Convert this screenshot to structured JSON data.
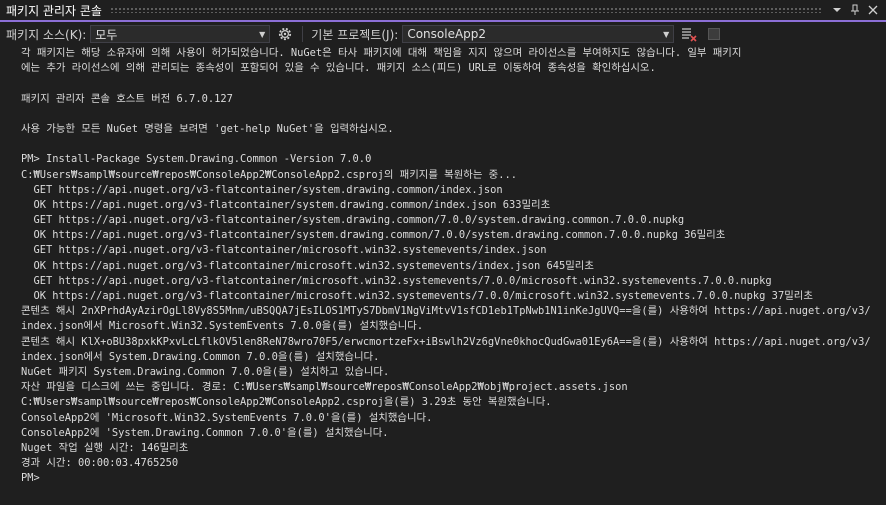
{
  "titlebar": {
    "title": "패키지 관리자 콘솔",
    "menu_icon": "dropdown-arrow-icon",
    "pin_icon": "pin-icon",
    "close_icon": "close-icon",
    "accent_color": "#8c6fd6"
  },
  "toolbar": {
    "source_label": "패키지 소스(K):",
    "source_value": "모두",
    "settings_icon": "gear-icon",
    "project_label": "기본 프로젝트(J):",
    "project_value": "ConsoleApp2",
    "clear_icon": "clear-console-icon",
    "stop_icon": "stop-icon"
  },
  "console": {
    "lines": [
      "각 패키지는 해당 소유자에 의해 사용이 허가되었습니다. NuGet은 타사 패키지에 대해 책임을 지지 않으며 라이선스를 부여하지도 않습니다. 일부 패키지",
      "에는 추가 라이선스에 의해 관리되는 종속성이 포함되어 있을 수 있습니다. 패키지 소스(피드) URL로 이동하여 종속성을 확인하십시오.",
      "",
      "패키지 관리자 콘솔 호스트 버전 6.7.0.127",
      "",
      "사용 가능한 모든 NuGet 명령을 보려면 'get-help NuGet'을 입력하십시오.",
      "",
      "PM> Install-Package System.Drawing.Common -Version 7.0.0",
      "C:₩Users₩sampl₩source₩repos₩ConsoleApp2₩ConsoleApp2.csproj의 패키지를 복원하는 중...",
      "  GET https://api.nuget.org/v3-flatcontainer/system.drawing.common/index.json",
      "  OK https://api.nuget.org/v3-flatcontainer/system.drawing.common/index.json 633밀리초",
      "  GET https://api.nuget.org/v3-flatcontainer/system.drawing.common/7.0.0/system.drawing.common.7.0.0.nupkg",
      "  OK https://api.nuget.org/v3-flatcontainer/system.drawing.common/7.0.0/system.drawing.common.7.0.0.nupkg 36밀리초",
      "  GET https://api.nuget.org/v3-flatcontainer/microsoft.win32.systemevents/index.json",
      "  OK https://api.nuget.org/v3-flatcontainer/microsoft.win32.systemevents/index.json 645밀리초",
      "  GET https://api.nuget.org/v3-flatcontainer/microsoft.win32.systemevents/7.0.0/microsoft.win32.systemevents.7.0.0.nupkg",
      "  OK https://api.nuget.org/v3-flatcontainer/microsoft.win32.systemevents/7.0.0/microsoft.win32.systemevents.7.0.0.nupkg 37밀리초",
      "콘텐츠 해시 2nXPrhdAyAzirOgLl8Vy8S5Mnm/uBSQQA7jEsILOS1MTyS7DbmV1NgViMtvV1sfCD1eb1TpNwb1N1inKeJgUVQ==을(를) 사용하여 https://api.nuget.org/v3/",
      "index.json에서 Microsoft.Win32.SystemEvents 7.0.0을(를) 설치했습니다.",
      "콘텐츠 해시 KlX+oBU38pxkKPxvLcLflkOV5len8ReN78wro70F5/erwcmortzeFx+iBswlh2Vz6gVne0khocQudGwa01Ey6A==을(를) 사용하여 https://api.nuget.org/v3/",
      "index.json에서 System.Drawing.Common 7.0.0을(를) 설치했습니다.",
      "NuGet 패키지 System.Drawing.Common 7.0.0을(를) 설치하고 있습니다.",
      "자산 파일을 디스크에 쓰는 중입니다. 경로: C:₩Users₩sampl₩source₩repos₩ConsoleApp2₩obj₩project.assets.json",
      "C:₩Users₩sampl₩source₩repos₩ConsoleApp2₩ConsoleApp2.csproj을(를) 3.29초 동안 복원했습니다.",
      "ConsoleApp2에 'Microsoft.Win32.SystemEvents 7.0.0'을(를) 설치했습니다.",
      "ConsoleApp2에 'System.Drawing.Common 7.0.0'을(를) 설치했습니다.",
      "Nuget 작업 실행 시간: 146밀리초",
      "경과 시간: 00:00:03.4765250",
      "PM> "
    ]
  }
}
